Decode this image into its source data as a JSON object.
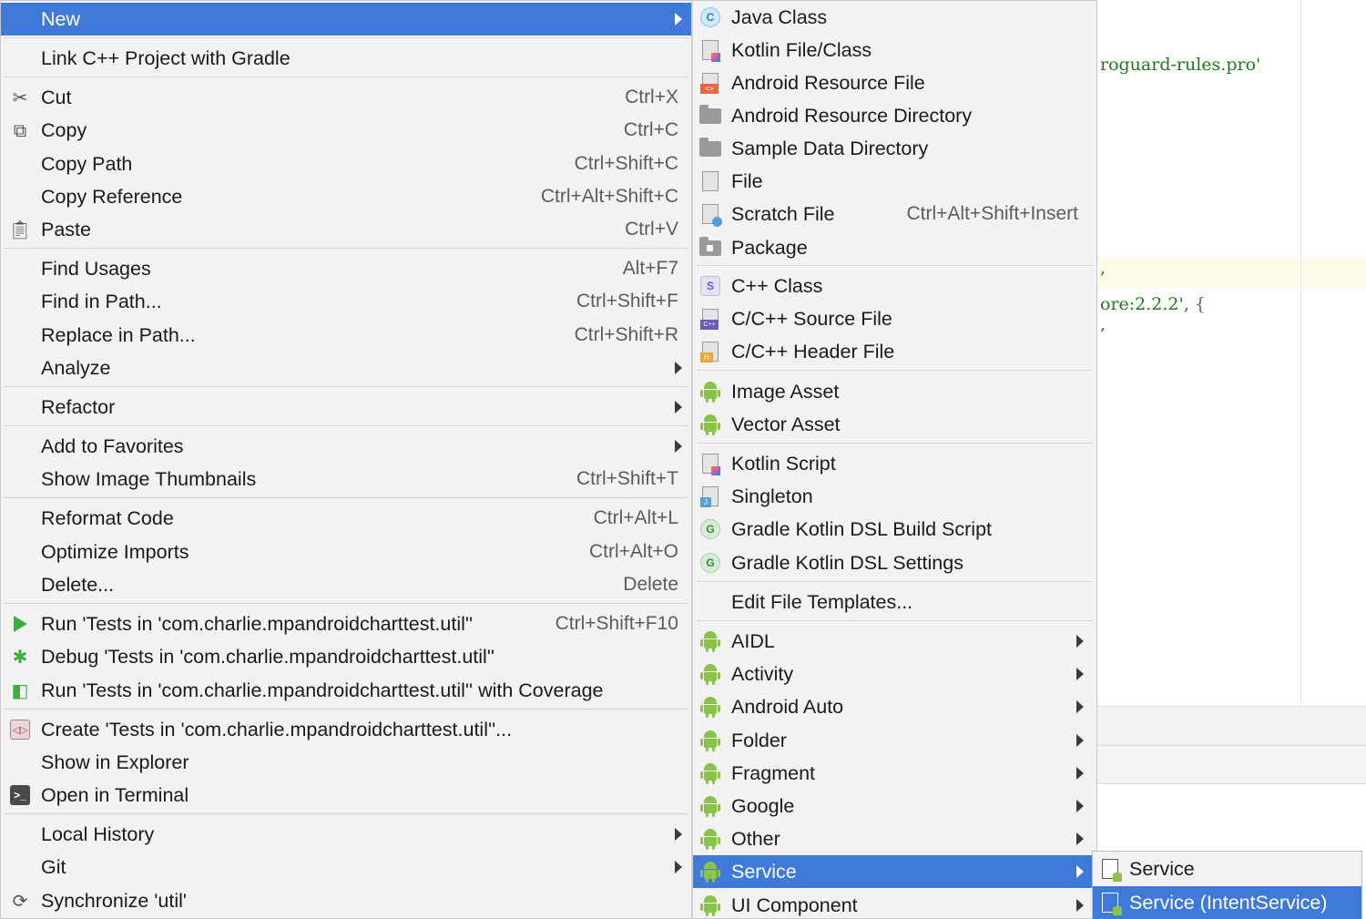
{
  "editor": {
    "line1": "roguard-rules.pro'",
    "line2": ",",
    "line3a": "ore:2.2.2',",
    "line3b": "{",
    "line4": ","
  },
  "main_menu": {
    "new": "New",
    "link_gradle": "Link C++ Project with Gradle",
    "cut": "Cut",
    "cut_sc": "Ctrl+X",
    "copy": "Copy",
    "copy_sc": "Ctrl+C",
    "copy_path": "Copy Path",
    "copy_path_sc": "Ctrl+Shift+C",
    "copy_reference": "Copy Reference",
    "copy_reference_sc": "Ctrl+Alt+Shift+C",
    "paste": "Paste",
    "paste_sc": "Ctrl+V",
    "find_usages": "Find Usages",
    "find_usages_sc": "Alt+F7",
    "find_in_path": "Find in Path...",
    "find_in_path_sc": "Ctrl+Shift+F",
    "replace_in_path": "Replace in Path...",
    "replace_in_path_sc": "Ctrl+Shift+R",
    "analyze": "Analyze",
    "refactor": "Refactor",
    "add_to_favorites": "Add to Favorites",
    "show_image_thumbnails": "Show Image Thumbnails",
    "show_image_thumbnails_sc": "Ctrl+Shift+T",
    "reformat_code": "Reformat Code",
    "reformat_code_sc": "Ctrl+Alt+L",
    "optimize_imports": "Optimize Imports",
    "optimize_imports_sc": "Ctrl+Alt+O",
    "delete": "Delete...",
    "delete_sc": "Delete",
    "run_tests": "Run 'Tests in 'com.charlie.mpandroidcharttest.util''",
    "run_tests_sc": "Ctrl+Shift+F10",
    "debug_tests": "Debug 'Tests in 'com.charlie.mpandroidcharttest.util''",
    "run_coverage": "Run 'Tests in 'com.charlie.mpandroidcharttest.util'' with Coverage",
    "create_tests": "Create 'Tests in 'com.charlie.mpandroidcharttest.util''...",
    "show_in_explorer": "Show in Explorer",
    "open_in_terminal": "Open in Terminal",
    "local_history": "Local History",
    "git": "Git",
    "synchronize": "Synchronize 'util'"
  },
  "new_menu": {
    "java_class": "Java Class",
    "kotlin_file": "Kotlin File/Class",
    "android_resource_file": "Android Resource File",
    "android_resource_directory": "Android Resource Directory",
    "sample_data_directory": "Sample Data Directory",
    "file": "File",
    "scratch_file": "Scratch File",
    "scratch_file_sc": "Ctrl+Alt+Shift+Insert",
    "package": "Package",
    "cpp_class": "C++ Class",
    "cpp_source": "C/C++ Source File",
    "cpp_header": "C/C++ Header File",
    "image_asset": "Image Asset",
    "vector_asset": "Vector Asset",
    "kotlin_script": "Kotlin Script",
    "singleton": "Singleton",
    "gradle_build_script": "Gradle Kotlin DSL Build Script",
    "gradle_settings": "Gradle Kotlin DSL Settings",
    "edit_file_templates": "Edit File Templates...",
    "aidl": "AIDL",
    "activity": "Activity",
    "android_auto": "Android Auto",
    "folder": "Folder",
    "fragment": "Fragment",
    "google": "Google",
    "other": "Other",
    "service": "Service",
    "ui_component": "UI Component"
  },
  "service_menu": {
    "service": "Service",
    "intent_service": "Service (IntentService)"
  },
  "colors": {
    "selection": "#3f7ad9",
    "menu_bg": "#f2f2f2",
    "android_green": "#8bc34a"
  }
}
